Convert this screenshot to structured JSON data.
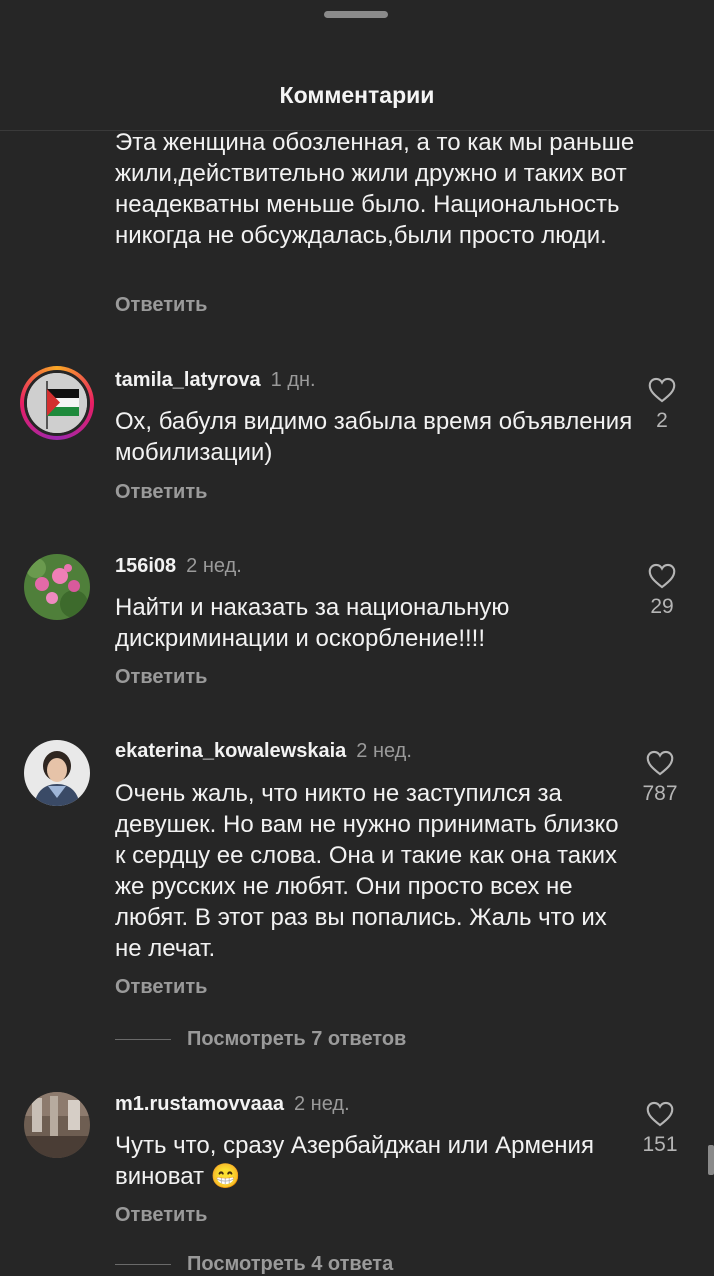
{
  "header": {
    "title": "Комментарии"
  },
  "top_comment": {
    "text": "Эта женщина  обозленная, а то как мы раньше жили,действительно жили дружно и таких вот неадекватны меньше было. Национальность никогда не обсуждалась,были просто люди.",
    "reply_label": "Ответить"
  },
  "comments": [
    {
      "username": "tamila_latyrova",
      "time": "1 дн.",
      "text": "Ох, бабуля видимо забыла время объявления мобилизации)",
      "reply_label": "Ответить",
      "likes": "2",
      "avatar": "palestine-flag-avatar"
    },
    {
      "username": "156i08",
      "time": "2 нед.",
      "text": "Найти и наказать за национальную дискриминации и оскорбление!!!!",
      "reply_label": "Ответить",
      "likes": "29",
      "avatar": "flowers-avatar"
    },
    {
      "username": "ekaterina_kowalewskaia",
      "time": "2 нед.",
      "text": "Очень жаль, что никто не заступился за девушек. Но вам не нужно принимать близко к сердцу ее слова. Она и такие как она таких же русских не любят. Они просто всех не любят. В этот раз вы попались. Жаль что их не лечат.",
      "reply_label": "Ответить",
      "likes": "787",
      "avatar": "woman-portrait-avatar",
      "view_replies": "Посмотреть 7 ответов"
    },
    {
      "username": "m1.rustamovvaaa",
      "time": "2 нед.",
      "text": "Чуть что, сразу Азербайджан или Армения виноват 😁",
      "reply_label": "Ответить",
      "likes": "151",
      "avatar": "interior-photo-avatar",
      "view_replies": "Посмотреть 4 ответа"
    }
  ],
  "colors": {
    "background": "#262626",
    "text": "#f2f2f2",
    "secondary": "#9a9a9a"
  }
}
